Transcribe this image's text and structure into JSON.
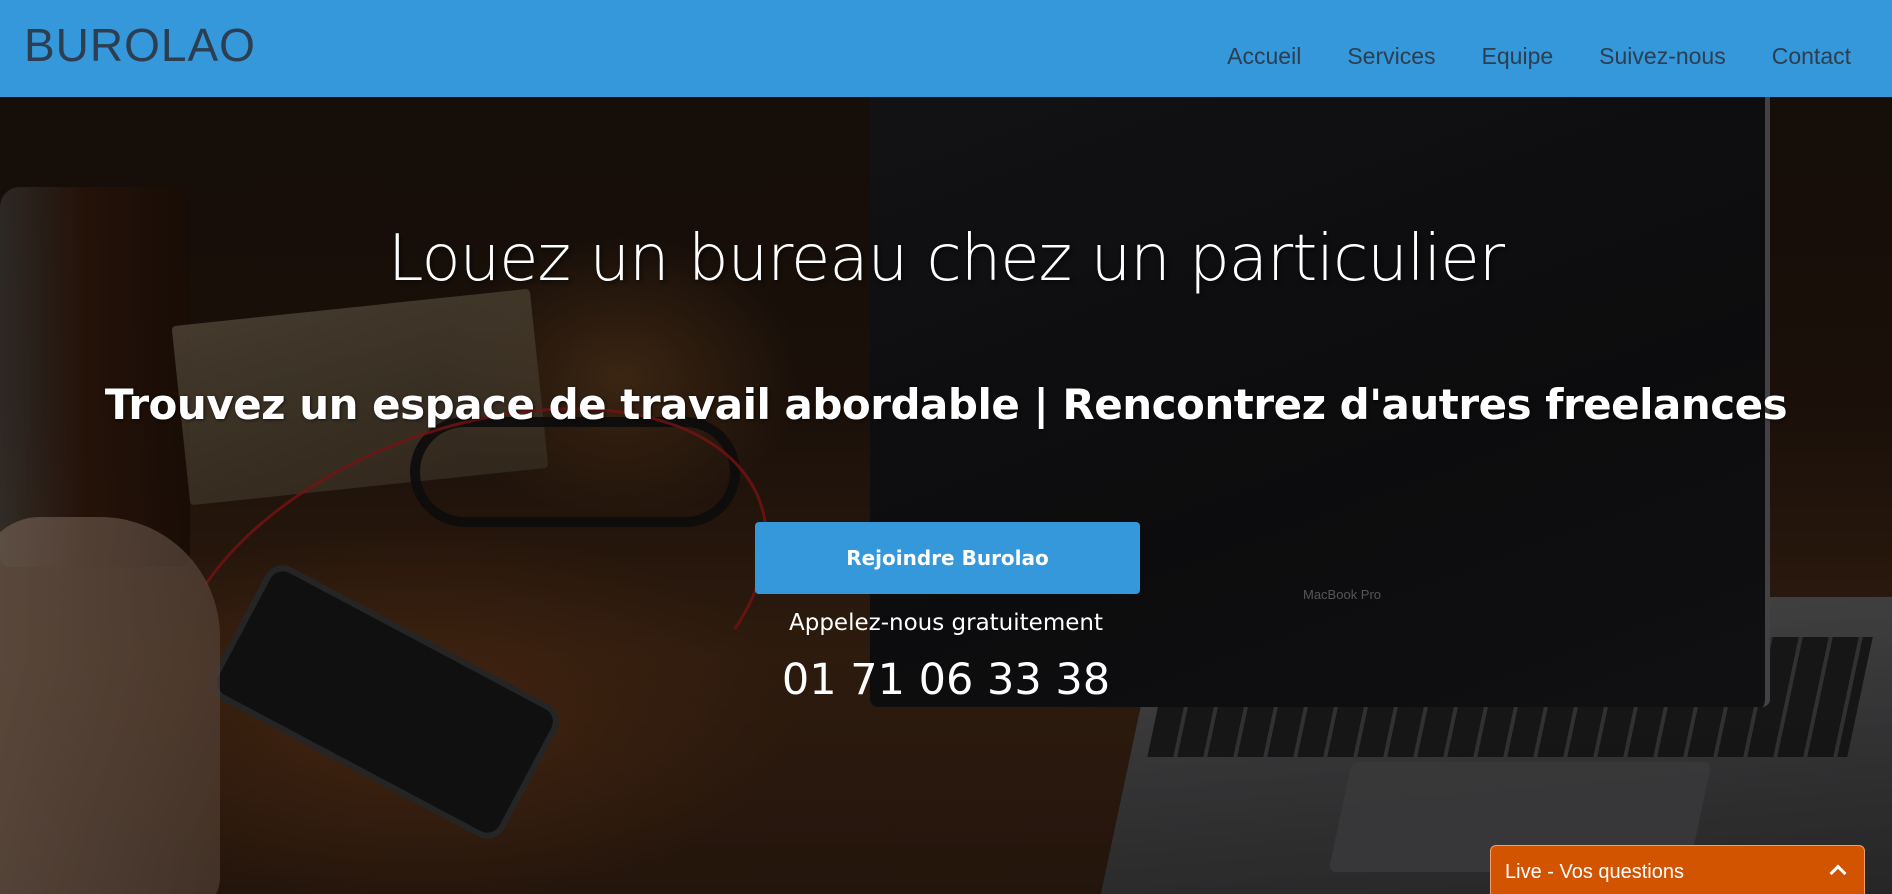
{
  "header": {
    "brand": "BUROLAO",
    "nav": [
      {
        "label": "Accueil"
      },
      {
        "label": "Services"
      },
      {
        "label": "Equipe"
      },
      {
        "label": "Suivez-nous"
      },
      {
        "label": "Contact"
      }
    ]
  },
  "hero": {
    "title": "Louez un bureau chez un particulier",
    "subtitle": "Trouvez un espace de travail abordable | Rencontrez d'autres freelances",
    "cta_label": "Rejoindre Burolao",
    "call_label": "Appelez-nous gratuitement",
    "phone": "01 71 06 33 38",
    "laptop_label": "MacBook Pro"
  },
  "livechat": {
    "label": "Live - Vos questions",
    "icon": "chevron-up-icon"
  },
  "colors": {
    "primary": "#3498db",
    "brand_text": "#2c3e50",
    "chat_accent": "#d35400"
  }
}
